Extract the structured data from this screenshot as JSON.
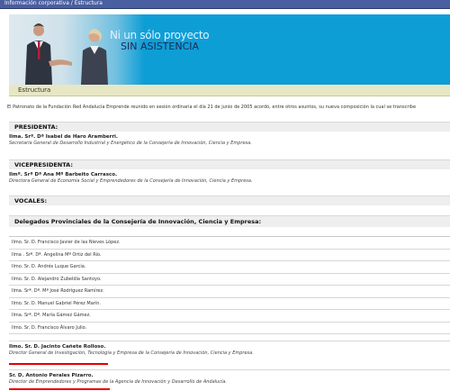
{
  "topbar": {
    "title": "Información corporativa / Estructura"
  },
  "banner": {
    "line1": "Ni un sólo proyecto",
    "line2": "SIN ASISTENCIA"
  },
  "section": {
    "title": "Estructura"
  },
  "intro": "El Patronato de la Fundación Red Andalucía Emprende reunido en sesión ordinaria el día 21 de junio de 2005 acordó, entre otros asuntos, su nueva composición la cual se transcribe",
  "presidenta": {
    "header": "PRESIDENTA:",
    "name": "Ilma. Srª. Dª Isabel de Haro Aramberri.",
    "role": "Secretaria General de Desarrollo Industrial y Energético de la Consejería de Innovación, Ciencia y Empresa."
  },
  "vicepresidenta": {
    "header": "VICEPRESIDENTA:",
    "name": "Ilmª. Srª Dª Ana Mª Barbeito Carrasco.",
    "role": "Directora General de Economía Social y Emprendedores de la Consejería de Innovación, Ciencia y Empresa."
  },
  "vocales": {
    "header": "VOCALES:"
  },
  "delegados": {
    "header": "Delegados Provinciales de la Consejería de Innovación, Ciencia y Empresa:",
    "rows": [
      "Ilmo. Sr. D. Francisco Javier de las Nieves López.",
      "Ilma . Srª. Dª. Angelina Mª Ortiz del Río.",
      "Ilmo. Sr. D. Andrés Luque García.",
      "Ilmo. Sr. D. Alejandro Zubeldía Santoyo.",
      "Ilma. Srª. Dª. Mª José Rodríguez Ramírez.",
      "Ilmo. Sr. D. Manuel Gabriel Pérez Marín.",
      "Ilma. Srª. Dª. María Gámez Gámez.",
      "Ilmo. Sr. D. Francisco Álvaro Julio."
    ]
  },
  "vocal1": {
    "name": "Ilmo. Sr. D. Jacinto Cañete Rolloso.",
    "role": "Director General de Investigación, Tecnología y Empresa de la Consejería de Innovación, Ciencia y Empresa."
  },
  "vocal2": {
    "name": "Sr. D. Antonio Perales Pizarro.",
    "role": "Director de Emprendedores y Programas de la Agencia de Innovación y Desarrollo de Andalucía."
  }
}
